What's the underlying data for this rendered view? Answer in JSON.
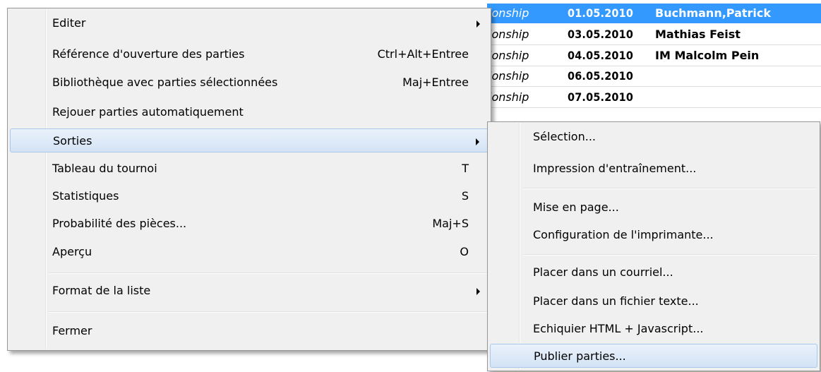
{
  "background_list": {
    "rows": [
      {
        "event": "ionship",
        "date": "01.05.2010",
        "player": "Buchmann,Patrick",
        "selected": true
      },
      {
        "event": "ionship",
        "date": "03.05.2010",
        "player": "Mathias Feist",
        "selected": false
      },
      {
        "event": "ionship",
        "date": "04.05.2010",
        "player": "IM Malcolm Pein",
        "selected": false
      },
      {
        "event": "ionship",
        "date": "06.05.2010",
        "player": "",
        "selected": false
      },
      {
        "event": "ionship",
        "date": "07.05.2010",
        "player": "",
        "selected": false
      }
    ]
  },
  "main_menu": {
    "items": [
      {
        "label": "Editer",
        "shortcut": "",
        "submenu": true
      },
      {
        "label": "Référence d'ouverture des parties",
        "shortcut": "Ctrl+Alt+Entree",
        "submenu": false
      },
      {
        "label": "Bibliothèque avec parties sélectionnées",
        "shortcut": "Maj+Entree",
        "submenu": false
      },
      {
        "label": "Rejouer parties automatiquement",
        "shortcut": "",
        "submenu": false
      },
      {
        "label": "Sorties",
        "shortcut": "",
        "submenu": true,
        "highlighted": true
      },
      {
        "label": "Tableau du tournoi",
        "shortcut": "T",
        "submenu": false
      },
      {
        "label": "Statistiques",
        "shortcut": "S",
        "submenu": false
      },
      {
        "label": "Probabilité des pièces...",
        "shortcut": "Maj+S",
        "submenu": false
      },
      {
        "label": "Aperçu",
        "shortcut": "O",
        "submenu": false
      },
      {
        "label": "Format de la liste",
        "shortcut": "",
        "submenu": true
      },
      {
        "label": "Fermer",
        "shortcut": "",
        "submenu": false
      }
    ]
  },
  "sub_menu": {
    "items": [
      {
        "label": "Sélection..."
      },
      {
        "label": "Impression d'entraînement..."
      },
      {
        "label": "Mise en page..."
      },
      {
        "label": "Configuration de l'imprimante..."
      },
      {
        "label": "Placer dans un courriel..."
      },
      {
        "label": "Placer dans un fichier texte..."
      },
      {
        "label": "Echiquier HTML + Javascript..."
      },
      {
        "label": "Publier parties...",
        "highlighted": true
      }
    ]
  },
  "colors": {
    "selection_blue": "#3399ff",
    "menu_bg": "#f0f0f0",
    "hover_border": "#a8c7ea"
  }
}
